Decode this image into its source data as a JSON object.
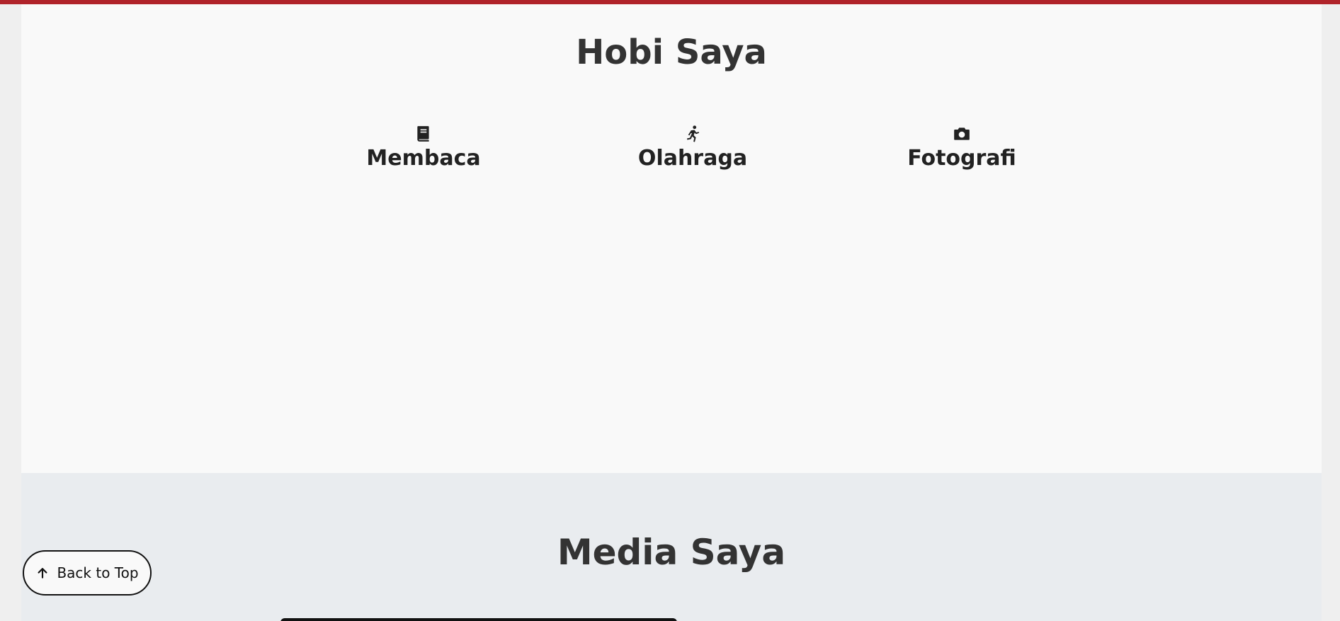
{
  "hobbies": {
    "title": "Hobi Saya",
    "items": [
      {
        "label": "Membaca",
        "icon": "book-icon"
      },
      {
        "label": "Olahraga",
        "icon": "running-icon"
      },
      {
        "label": "Fotografi",
        "icon": "camera-icon"
      }
    ]
  },
  "media": {
    "title": "Media Saya"
  },
  "back_to_top": {
    "label": "Back to Top",
    "icon": "arrow-up-icon"
  },
  "colors": {
    "accent_bar": "#b0232a",
    "hobbies_bg": "#f9f9f9",
    "media_bg": "#e9ecef",
    "title_text": "#333333"
  }
}
